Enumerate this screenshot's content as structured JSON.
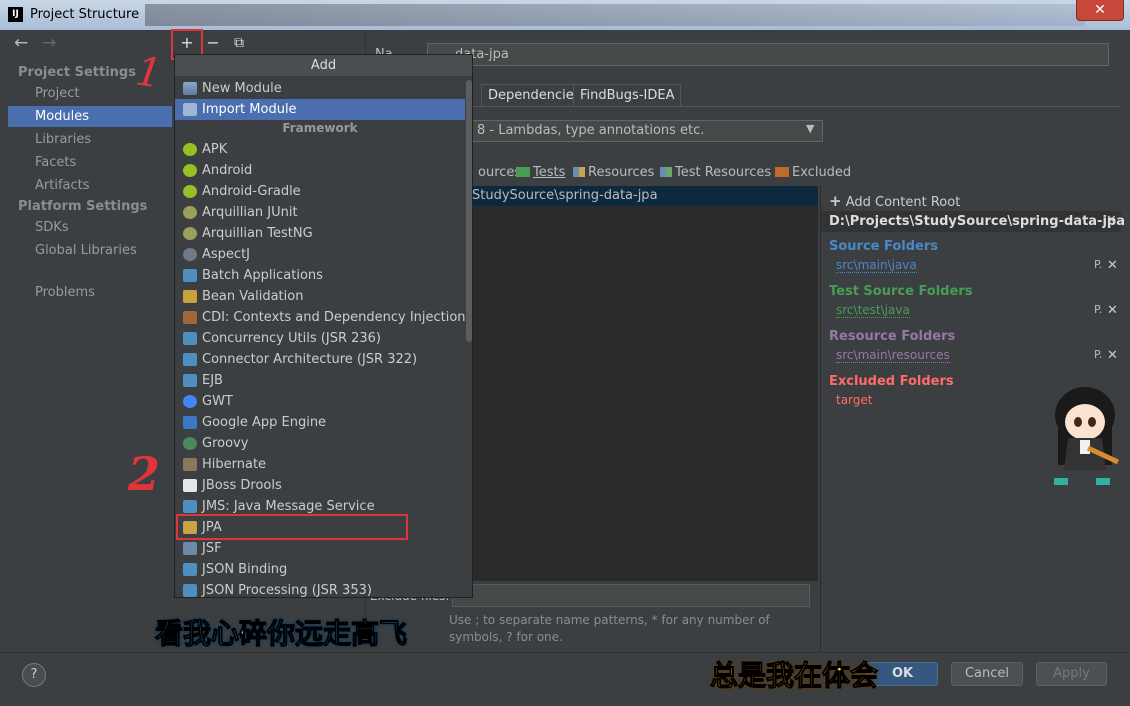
{
  "window": {
    "title": "Project Structure",
    "app_icon_text": "IJ",
    "close_symbol": "✕"
  },
  "nav": {
    "back_arrow": "←",
    "forward_arrow": "→",
    "project_settings_header": "Project Settings",
    "project_settings": [
      "Project",
      "Modules",
      "Libraries",
      "Facets",
      "Artifacts"
    ],
    "platform_settings_header": "Platform Settings",
    "platform_settings": [
      "SDKs",
      "Global Libraries"
    ],
    "problems": "Problems",
    "selected": "Modules"
  },
  "toolbar": {
    "add": "+",
    "remove": "−",
    "copy": "⧉"
  },
  "module": {
    "name_label": "Na",
    "name_value": "data-jpa",
    "tabs": [
      "Dependencies",
      "FindBugs-IDEA"
    ],
    "language_level": "8 - Lambdas, type annotations etc.",
    "mark_as": [
      "ources",
      "Tests",
      "Resources",
      "Test Resources",
      "Excluded"
    ],
    "tree_root": "StudySource\\spring-data-jpa",
    "exclude_label": "Exclude files:",
    "exclude_value": "",
    "hint": "Use ; to separate name patterns, * for any number of symbols, ? for one."
  },
  "content_root": {
    "add_label": "Add Content Root",
    "path": "D:\\Projects\\StudySource\\spring-data-jpa",
    "source_folders_label": "Source Folders",
    "source_folders": [
      "src\\main\\java"
    ],
    "test_source_folders_label": "Test Source Folders",
    "test_source_folders": [
      "src\\test\\java"
    ],
    "resource_folders_label": "Resource Folders",
    "resource_folders": [
      "src\\main\\resources"
    ],
    "excluded_folders_label": "Excluded Folders",
    "excluded_folders": [
      "target"
    ],
    "row_actions": [
      "P.",
      "✕"
    ]
  },
  "add_popup": {
    "header": "Add",
    "top_items": [
      "New Module",
      "Import Module"
    ],
    "framework_header": "Framework",
    "frameworks": [
      {
        "label": "APK",
        "icon": "android-icon"
      },
      {
        "label": "Android",
        "icon": "android-icon"
      },
      {
        "label": "Android-Gradle",
        "icon": "android-icon"
      },
      {
        "label": "Arquillian JUnit",
        "icon": "arquillian-icon"
      },
      {
        "label": "Arquillian TestNG",
        "icon": "arquillian-icon"
      },
      {
        "label": "AspectJ",
        "icon": "aspectj-icon"
      },
      {
        "label": "Batch Applications",
        "icon": "module-icon"
      },
      {
        "label": "Bean Validation",
        "icon": "bean-icon"
      },
      {
        "label": "CDI: Contexts and Dependency Injection",
        "icon": "cdi-icon"
      },
      {
        "label": "Concurrency Utils (JSR 236)",
        "icon": "module-icon"
      },
      {
        "label": "Connector Architecture (JSR 322)",
        "icon": "module-icon"
      },
      {
        "label": "EJB",
        "icon": "module-icon"
      },
      {
        "label": "GWT",
        "icon": "google-icon"
      },
      {
        "label": "Google App Engine",
        "icon": "appengine-icon"
      },
      {
        "label": "Groovy",
        "icon": "groovy-icon"
      },
      {
        "label": "Hibernate",
        "icon": "hibernate-icon"
      },
      {
        "label": "JBoss Drools",
        "icon": "drools-icon"
      },
      {
        "label": "JMS: Java Message Service",
        "icon": "module-icon"
      },
      {
        "label": "JPA",
        "icon": "jpa-icon"
      },
      {
        "label": "JSF",
        "icon": "jsf-icon"
      },
      {
        "label": "JSON Binding",
        "icon": "module-icon"
      },
      {
        "label": "JSON Processing (JSR 353)",
        "icon": "module-icon"
      }
    ],
    "selected": "Import Module"
  },
  "buttons": {
    "help": "?",
    "ok": "OK",
    "cancel": "Cancel",
    "apply": "Apply"
  },
  "annotations": {
    "step1": "1",
    "step2": "2"
  },
  "subtitles": [
    "看我心碎你远走高飞",
    "总是我在体会"
  ],
  "colors": {
    "selection": "#4b6eaf",
    "source": "#4a88c7",
    "test": "#499c54",
    "resource": "#9876aa",
    "excluded": "#ff6b68",
    "annotation_red": "#e0343b"
  }
}
